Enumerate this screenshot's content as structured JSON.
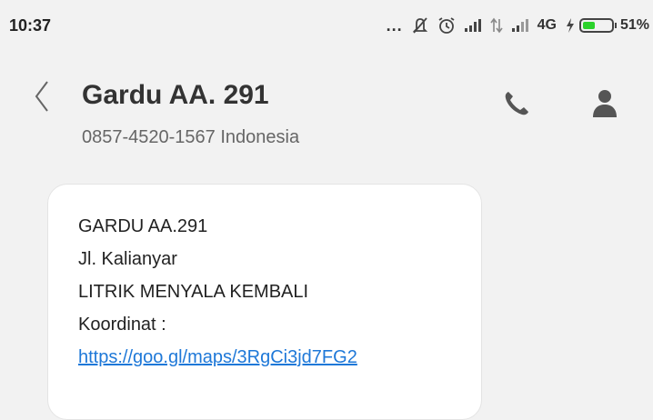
{
  "status_bar": {
    "time": "10:37",
    "more_indicator": "...",
    "network_type": "4G",
    "battery_percent": "51%",
    "battery_level": 0.51,
    "battery_color": "#2bd22b",
    "icons": [
      "mute-icon",
      "alarm-icon",
      "signal-icon",
      "data-transfer-icon",
      "signal-icon",
      "charging-icon",
      "battery-icon"
    ]
  },
  "header": {
    "contact_name": "Gardu AA. 291",
    "contact_number": "0857-4520-1567 Indonesia",
    "back_icon": "chevron-left-icon",
    "call_icon": "phone-icon",
    "profile_icon": "person-icon"
  },
  "message": {
    "lines": [
      "GARDU AA.291",
      "Jl. Kalianyar",
      "LITRIK MENYALA KEMBALI",
      "Koordinat :"
    ],
    "link": "https://goo.gl/maps/3RgCi3jd7FG2",
    "link_color": "#1e78d8"
  }
}
